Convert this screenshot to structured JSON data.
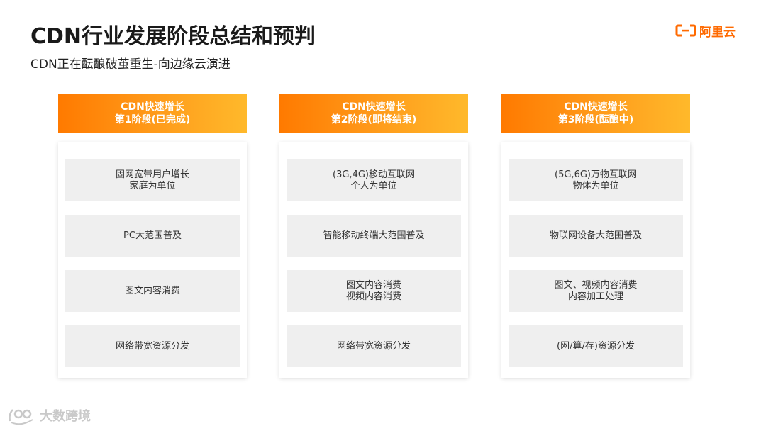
{
  "header": {
    "title": "CDN行业发展阶段总结和预判",
    "subtitle": "CDN正在酝酿破茧重生-向边缘云演进"
  },
  "logo": {
    "text": "阿里云",
    "color": "#ff6a00"
  },
  "stages": [
    {
      "header_line1": "CDN快速增长",
      "header_line2": "第1阶段(已完成)",
      "items": [
        {
          "line1": "固网宽带用户增长",
          "line2": "家庭为单位"
        },
        {
          "line1": "PC大范围普及",
          "line2": ""
        },
        {
          "line1": "图文内容消费",
          "line2": ""
        },
        {
          "line1": "网络带宽资源分发",
          "line2": ""
        }
      ]
    },
    {
      "header_line1": "CDN快速增长",
      "header_line2": "第2阶段(即将结束)",
      "items": [
        {
          "line1": "(3G,4G)移动互联网",
          "line2": "个人为单位"
        },
        {
          "line1": "智能移动终端大范围普及",
          "line2": ""
        },
        {
          "line1": "图文内容消费",
          "line2": "视频内容消费"
        },
        {
          "line1": "网络带宽资源分发",
          "line2": ""
        }
      ]
    },
    {
      "header_line1": "CDN快速增长",
      "header_line2": "第3阶段(酝酿中)",
      "items": [
        {
          "line1": "(5G,6G)万物互联网",
          "line2": "物体为单位"
        },
        {
          "line1": "物联网设备大范围普及",
          "line2": ""
        },
        {
          "line1": "图文、视频内容消费",
          "line2": "内容加工处理"
        },
        {
          "line1": "(网/算/存)资源分发",
          "line2": ""
        }
      ]
    }
  ],
  "watermark": {
    "text": "大数跨境"
  },
  "colors": {
    "header_gradient_start": "#ff7a00",
    "header_gradient_end": "#ffb92b",
    "item_background": "#efefef"
  }
}
